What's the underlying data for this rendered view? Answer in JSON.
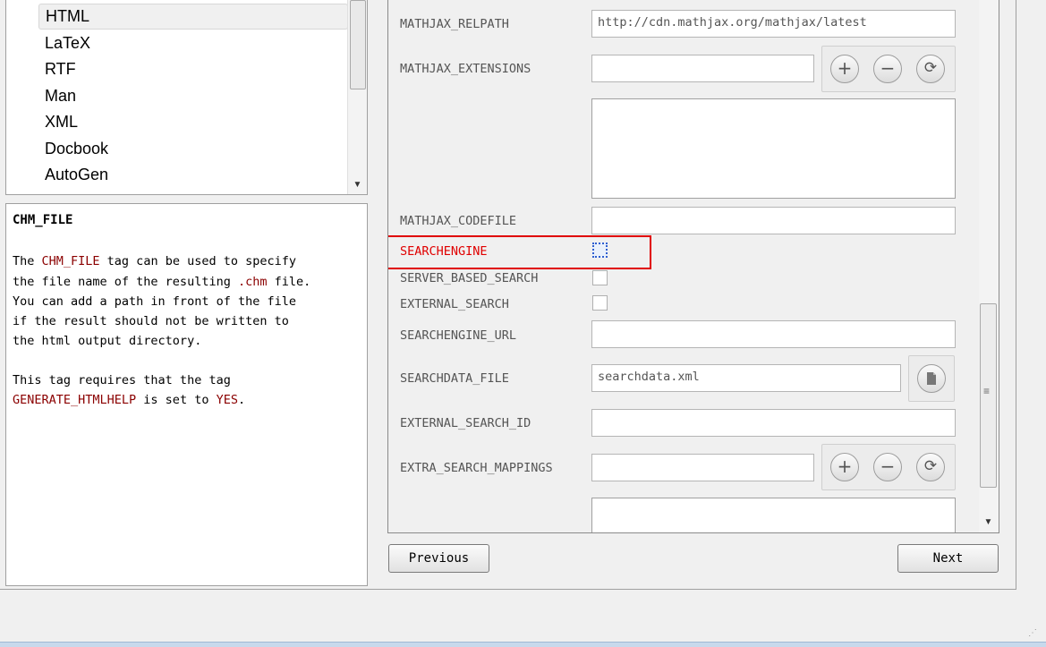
{
  "topics": {
    "items": [
      "HTML",
      "LaTeX",
      "RTF",
      "Man",
      "XML",
      "Docbook",
      "AutoGen"
    ],
    "selected": "HTML"
  },
  "help": {
    "title": "CHM_FILE",
    "line1_pre": "The ",
    "line1_tag": "CHM_FILE",
    "line1_post": " tag can be used to specify",
    "line2_pre": "the file name of the resulting ",
    "line2_code": ".chm",
    "line2_post": " file.",
    "line3": "You can add a path in front of the file",
    "line4": "if the result should not be written to",
    "line5": "the html output directory.",
    "line6": "This tag requires that the tag",
    "line7_tag": "GENERATE_HTMLHELP",
    "line7_mid": " is set to ",
    "line7_val": "YES",
    "line7_end": "."
  },
  "settings": {
    "mathjax_relpath": {
      "label": "MATHJAX_RELPATH",
      "value": "http://cdn.mathjax.org/mathjax/latest"
    },
    "mathjax_extensions": {
      "label": "MATHJAX_EXTENSIONS",
      "value": ""
    },
    "mathjax_codefile": {
      "label": "MATHJAX_CODEFILE",
      "value": ""
    },
    "searchengine": {
      "label": "SEARCHENGINE",
      "checked": false
    },
    "server_based_search": {
      "label": "SERVER_BASED_SEARCH",
      "checked": false
    },
    "external_search": {
      "label": "EXTERNAL_SEARCH",
      "checked": false
    },
    "searchengine_url": {
      "label": "SEARCHENGINE_URL",
      "value": ""
    },
    "searchdata_file": {
      "label": "SEARCHDATA_FILE",
      "value": "searchdata.xml"
    },
    "external_search_id": {
      "label": "EXTERNAL_SEARCH_ID",
      "value": ""
    },
    "extra_search_mappings": {
      "label": "EXTRA_SEARCH_MAPPINGS",
      "value": ""
    }
  },
  "icons": {
    "add": "plus-icon",
    "remove": "minus-icon",
    "reset": "refresh-icon",
    "file": "file-icon"
  },
  "nav": {
    "previous_label": "Previous",
    "next_label": "Next"
  },
  "colors": {
    "active_label": "#e00000",
    "highlight_border": "#e00000"
  }
}
